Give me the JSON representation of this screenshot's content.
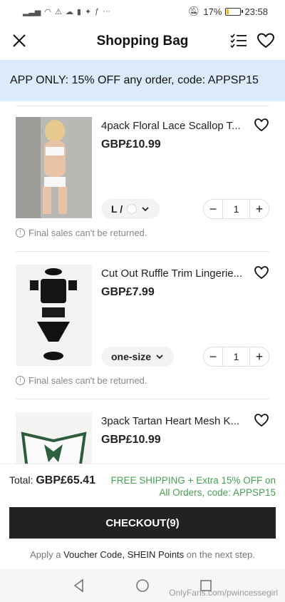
{
  "status_bar": {
    "battery": "17%",
    "battery_level": 0.17,
    "time": "23:58"
  },
  "header": {
    "title": "Shopping Bag"
  },
  "promo_banner": {
    "text": "APP ONLY: 15% OFF any order, code: APPSP15"
  },
  "items": [
    {
      "name": "4pack Floral Lace Scallop T...",
      "price": "GBP£10.99",
      "variant": "L /",
      "quantity": "1",
      "notice": "Final sales can't be returned."
    },
    {
      "name": "Cut Out Ruffle Trim Lingerie...",
      "price": "GBP£7.99",
      "variant": "one-size",
      "quantity": "1",
      "notice": "Final sales can't be returned."
    },
    {
      "name": "3pack Tartan Heart Mesh K...",
      "price": "GBP£10.99"
    }
  ],
  "footer": {
    "total_label": "Total:",
    "total_value": "GBP£65.41",
    "shipping_text": "FREE SHIPPING + Extra 15% OFF on All Orders, code: APPSP15",
    "checkout_label": "CHECKOUT(9)",
    "hint_prefix": "Apply a",
    "hint_link": "Voucher Code, SHEIN Points",
    "hint_suffix": "on the next step."
  },
  "watermark": "OnlyFans.com/pwincessegirl",
  "colors": {
    "promo_bg": "#dcebfb",
    "shipping_green": "#48a051",
    "checkout_bg": "#222222"
  }
}
